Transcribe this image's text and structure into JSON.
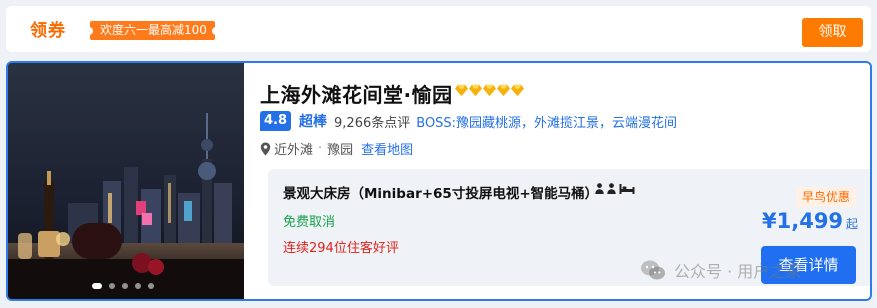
{
  "coupon": {
    "title": "领券",
    "tag": "欢度六一最高减100",
    "claim_label": "领取"
  },
  "hotel": {
    "name": "上海外滩花间堂·愉园",
    "diamond_count": 5,
    "score": "4.8",
    "score_word": "超棒",
    "reviews": "9,266条点评",
    "boss": "BOSS:豫园藏桃源，外滩揽江景，云端漫花间",
    "location_near": "近外滩",
    "location_area": "豫园",
    "map_link": "查看地图",
    "photo_icon": "hotel-night-view-photo",
    "carousel": {
      "total": 5,
      "active": 0
    }
  },
  "room": {
    "name": "景观大床房（Minibar+65寸投屏电视+智能马桶）",
    "free_cancel": "免费取消",
    "praise": "连续294位住客好评",
    "icons": [
      "person-icon",
      "person-icon",
      "bed-icon"
    ]
  },
  "offer": {
    "promo": "早鸟优惠",
    "price": "¥1,499",
    "price_suffix": "起",
    "detail_label": "查看详情"
  },
  "watermark": {
    "text": "公众号 · 用户之家",
    "icon": "wechat-icon"
  },
  "colors": {
    "accent_orange": "#ff7a00",
    "brand_blue": "#2470e6",
    "green": "#17a34a",
    "red": "#e2231a"
  }
}
